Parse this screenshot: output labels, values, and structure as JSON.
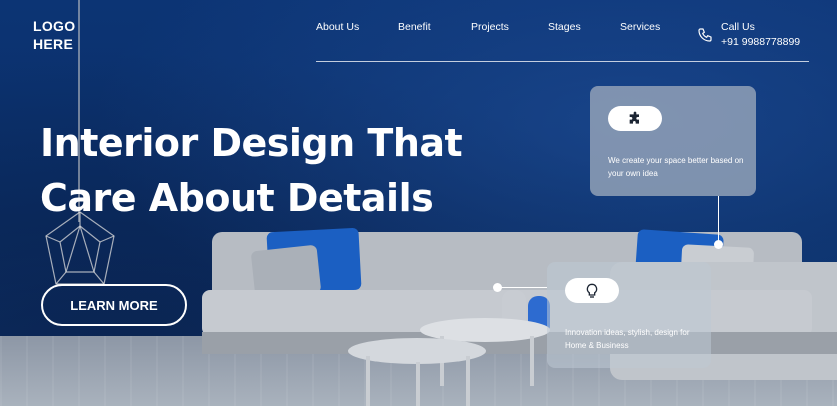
{
  "logo": {
    "line1": "LOGO",
    "line2": "HERE"
  },
  "nav": {
    "items": [
      "About Us",
      "Benefit",
      "Projects",
      "Stages",
      "Services"
    ]
  },
  "contact": {
    "label": "Call Us",
    "phone": "+91 9988778899",
    "icon": "phone-icon"
  },
  "hero": {
    "headline_line1": "Interior Design That",
    "headline_line2": "Care About Details",
    "cta_label": "LEARN MORE"
  },
  "cards": [
    {
      "icon": "puzzle-icon",
      "text": "We create your space better based on your own idea"
    },
    {
      "icon": "lightbulb-icon",
      "text": "Innovation ideas, stylish, design for Home & Business"
    }
  ],
  "colors": {
    "background": "#0c3474",
    "accent": "#1b5fc2",
    "text": "#ffffff"
  }
}
